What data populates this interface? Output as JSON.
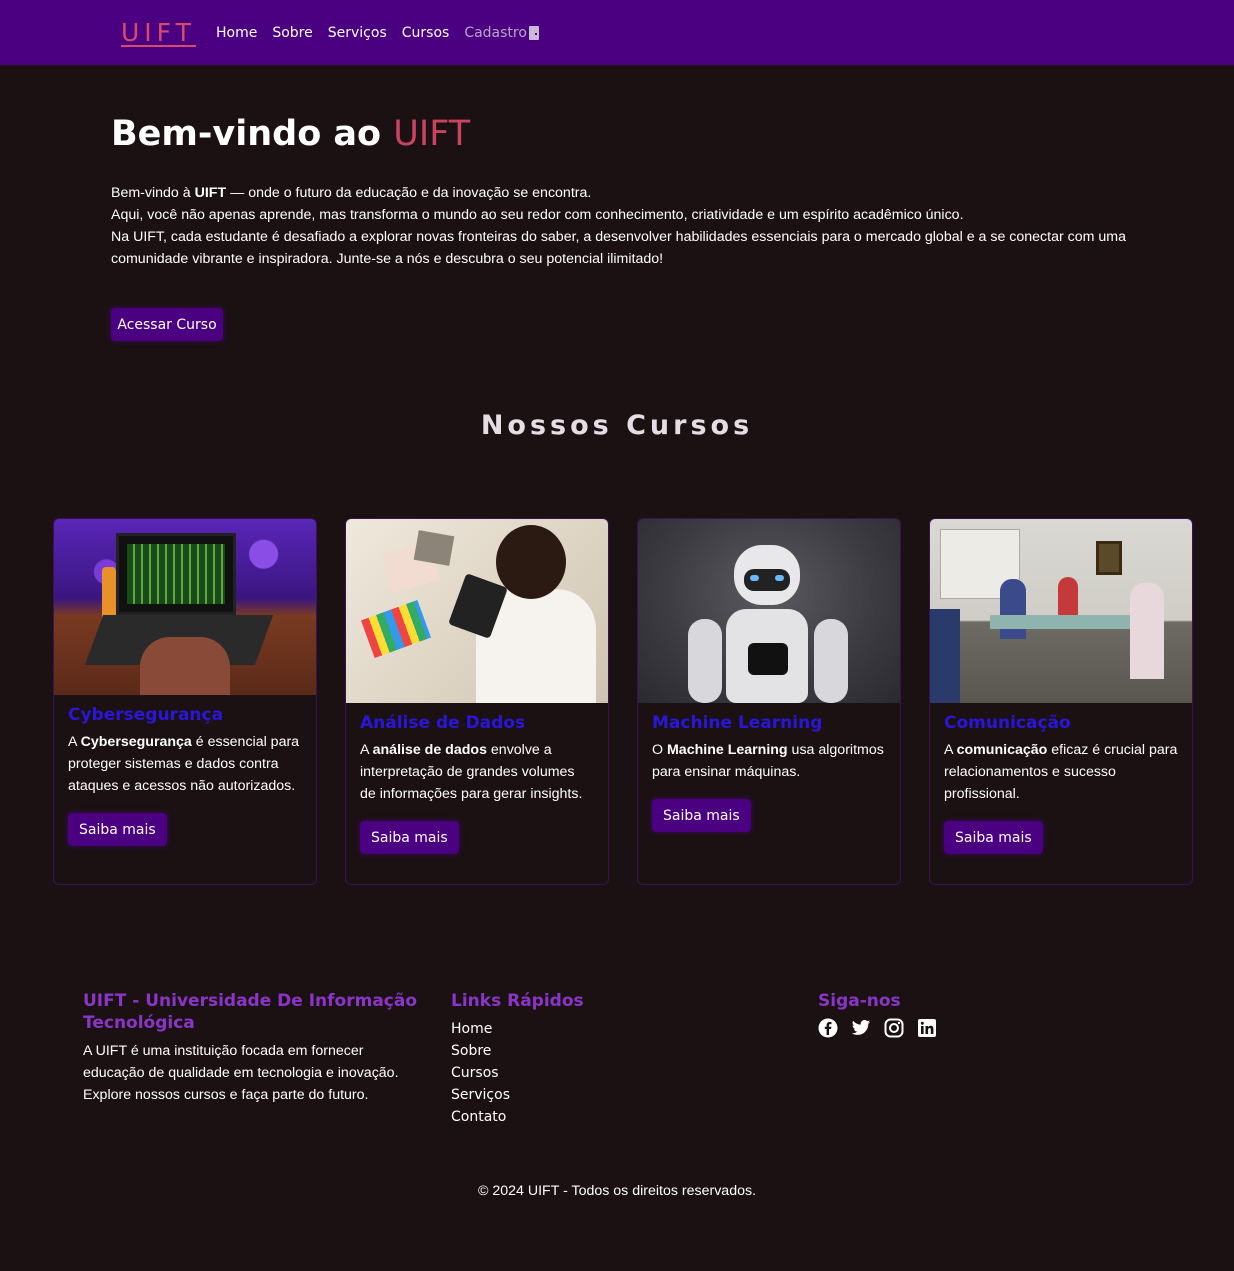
{
  "nav": {
    "logo": "UIFT",
    "links": [
      "Home",
      "Sobre",
      "Serviços",
      "Cursos"
    ],
    "signup": "Cadastro"
  },
  "hero": {
    "title_prefix": "Bem-vindo ao ",
    "title_accent": "UIFT",
    "line1_pre": "Bem-vindo à ",
    "line1_bold": "UIFT",
    "line1_post": " — onde o futuro da educação e da inovação se encontra.",
    "line2": "Aqui, você não apenas aprende, mas transforma o mundo ao seu redor com conhecimento, criatividade e um espírito acadêmico único.",
    "line3": "Na UIFT, cada estudante é desafiado a explorar novas fronteiras do saber, a desenvolver habilidades essenciais para o mercado global e a se conectar com uma comunidade vibrante e inspiradora. Junte-se a nós e descubra o seu potencial ilimitado!",
    "button": "Acessar Curso"
  },
  "courses": {
    "section_title": "Nossos Cursos",
    "items": [
      {
        "title": "Cybersegurança",
        "pre": "A ",
        "bold": "Cybersegurança",
        "post": " é essencial para proteger sistemas e dados contra ataques e acessos não autorizados.",
        "button": "Saiba mais"
      },
      {
        "title": "Análise de Dados",
        "pre": "A ",
        "bold": "análise de dados",
        "post": " envolve a interpretação de grandes volumes de informações para gerar insights.",
        "button": "Saiba mais"
      },
      {
        "title": "Machine Learning",
        "pre": "O ",
        "bold": "Machine Learning",
        "post": " usa algoritmos para ensinar máquinas.",
        "button": "Saiba mais"
      },
      {
        "title": "Comunicação",
        "pre": "A ",
        "bold": "comunicação",
        "post": " eficaz é crucial para relacionamentos e sucesso profissional.",
        "button": "Saiba mais"
      }
    ]
  },
  "footer": {
    "about_title": "UIFT - Universidade De Informação Tecnológica",
    "about_text": "A UIFT é uma instituição focada em fornecer educação de qualidade em tecnologia e inovação. Explore nossos cursos e faça parte do futuro.",
    "links_title": "Links Rápidos",
    "links": [
      "Home",
      "Sobre",
      "Cursos",
      "Serviços",
      "Contato"
    ],
    "social_title": "Siga-nos",
    "socials": [
      "facebook-icon",
      "twitter-icon",
      "instagram-icon",
      "linkedin-icon"
    ],
    "copyright": "© 2024 UIFT - Todos os direitos reservados."
  },
  "colors": {
    "nav_bg": "#4b0082",
    "page_bg": "#1b1113",
    "accent_pink": "#c9445e",
    "course_title": "#2a16d8",
    "footer_title": "#8a35c8"
  }
}
